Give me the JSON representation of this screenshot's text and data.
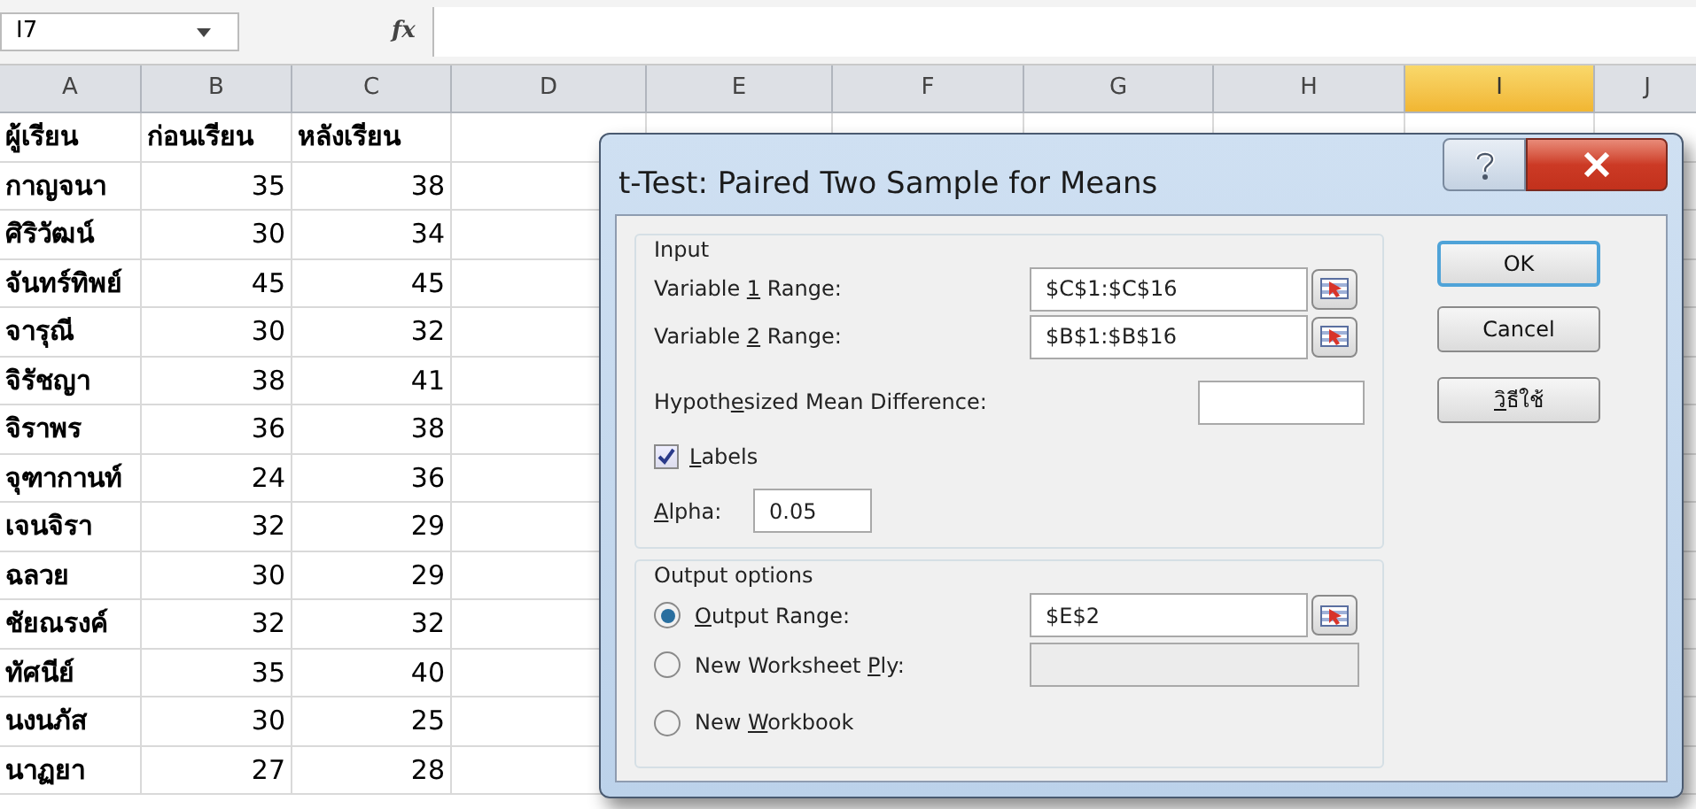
{
  "formula_bar": {
    "name_box": "I7",
    "function_label": "fx"
  },
  "columns": [
    {
      "label": "A",
      "selected": false
    },
    {
      "label": "B",
      "selected": false
    },
    {
      "label": "C",
      "selected": false
    },
    {
      "label": "D",
      "selected": false
    },
    {
      "label": "E",
      "selected": false
    },
    {
      "label": "F",
      "selected": false
    },
    {
      "label": "G",
      "selected": false
    },
    {
      "label": "H",
      "selected": false
    },
    {
      "label": "I",
      "selected": true
    },
    {
      "label": "J",
      "selected": false
    }
  ],
  "rows": [
    [
      "ผู้เรียน",
      "ก่อนเรียน",
      "หลังเรียน"
    ],
    [
      "กาญจนา",
      "35",
      "38"
    ],
    [
      "ศิริวัฒน์",
      "30",
      "34"
    ],
    [
      "จันทร์ทิพย์",
      "45",
      "45"
    ],
    [
      "จารุณี",
      "30",
      "32"
    ],
    [
      "จิรัชญา",
      "38",
      "41"
    ],
    [
      "จิราพร",
      "36",
      "38"
    ],
    [
      "จุฑากานท์",
      "24",
      "36"
    ],
    [
      "เจนจิรา",
      "32",
      "29"
    ],
    [
      "ฉลวย",
      "30",
      "29"
    ],
    [
      "ชัยณรงค์",
      "32",
      "32"
    ],
    [
      "ทัศนีย์",
      "35",
      "40"
    ],
    [
      "นงนภัส",
      "30",
      "25"
    ],
    [
      "นาฏยา",
      "27",
      "28"
    ]
  ],
  "dialog": {
    "title": "t-Test: Paired Two Sample for Means",
    "input": {
      "title": "Input",
      "variable_1": {
        "label": {
          "pre": "Variable ",
          "key": "1",
          "post": " Range:"
        },
        "value": "$C$1:$C$16"
      },
      "variable_2": {
        "label": {
          "pre": "Variable ",
          "key": "2",
          "post": " Range:"
        },
        "value": "$B$1:$B$16"
      },
      "hypothesized": {
        "label": {
          "pre": "Hypoth",
          "key": "e",
          "post": "sized Mean Difference:"
        }
      },
      "labels": {
        "label": {
          "key": "L",
          "post": "abels"
        },
        "checked": true
      },
      "alpha": {
        "label": {
          "key": "A",
          "post": "lpha:"
        },
        "value": "0.05"
      }
    },
    "output": {
      "title": "Output options",
      "options": [
        {
          "label": {
            "key": "O",
            "post": "utput Range:"
          },
          "selected": true,
          "value": "$E$2",
          "enabled": true
        },
        {
          "label": {
            "pre": "New Worksheet ",
            "key": "P",
            "post": "ly:"
          },
          "selected": false,
          "enabled": false
        },
        {
          "label": {
            "pre": "New ",
            "key": "W",
            "post": "orkbook"
          },
          "selected": false
        }
      ]
    },
    "buttons": [
      {
        "label": {
          "post": "OK"
        },
        "default": true
      },
      {
        "label": {
          "post": "Cancel"
        },
        "default": false
      },
      {
        "label": {
          "key": "วิ",
          "post": "ธีใช้"
        },
        "default": false
      }
    ]
  }
}
